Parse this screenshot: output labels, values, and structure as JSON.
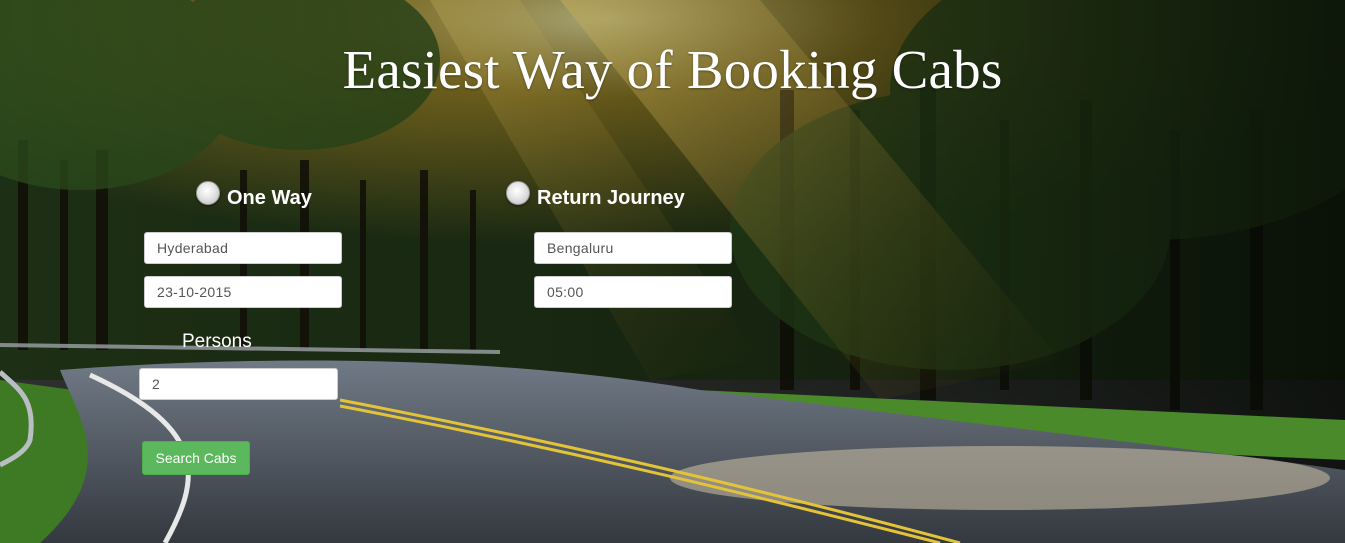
{
  "page": {
    "title": "Easiest Way of Booking Cabs"
  },
  "trip_type": {
    "options": [
      {
        "label": "One Way",
        "selected": false
      },
      {
        "label": "Return Journey",
        "selected": false
      }
    ]
  },
  "form": {
    "from": {
      "value": "Hyderabad"
    },
    "to": {
      "value": "Bengaluru"
    },
    "date": {
      "value": "23-10-2015"
    },
    "time": {
      "value": "05:00"
    },
    "persons": {
      "label": "Persons",
      "value": "2"
    },
    "submit_label": "Search Cabs"
  },
  "colors": {
    "accent_button": "#5cb85c",
    "title_text": "#ffffff"
  },
  "icons": {
    "radio": "radio-button-icon"
  }
}
